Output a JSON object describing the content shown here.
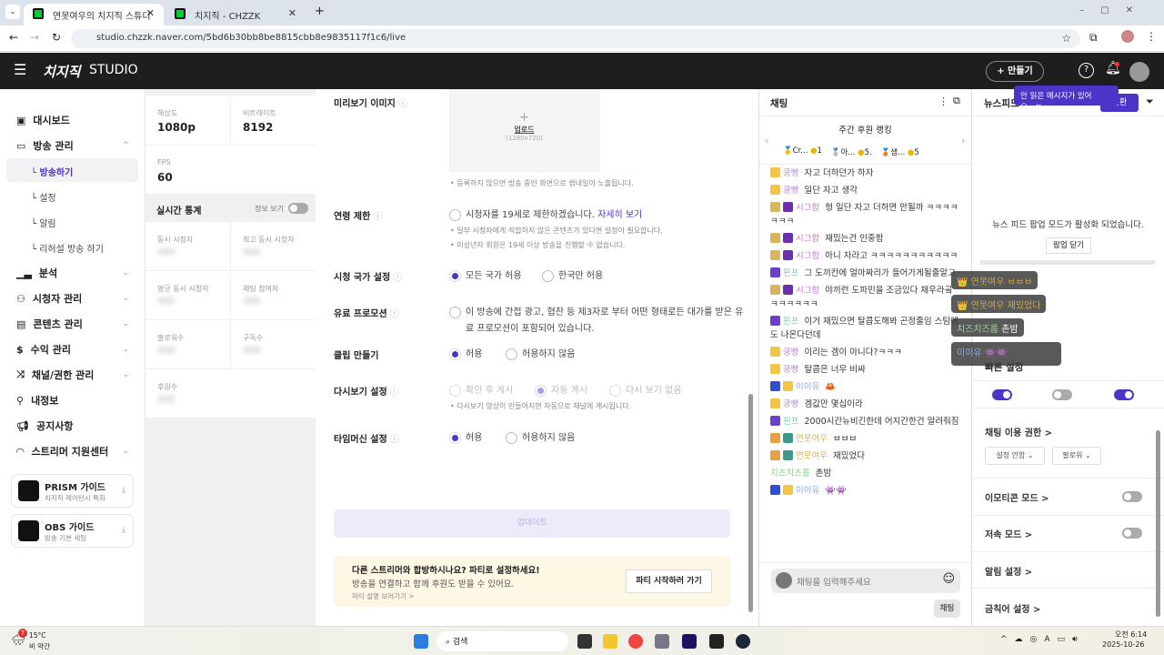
{
  "browser": {
    "tabs": [
      {
        "title": "연못여우의 치지직 스튜디오"
      },
      {
        "title": "치지직 - CHZZK"
      }
    ],
    "url": "studio.chzzk.naver.com/5bd6b30bb8be8815cbb8e9835117f1c6/live"
  },
  "header": {
    "logo": "치지직",
    "studio": "STUDIO",
    "create": "+ 만들기",
    "tooltip": "안 읽은 메시지가 있어요."
  },
  "sidebar": {
    "items": [
      "대시보드",
      "방송 관리",
      "분석",
      "시청자 관리",
      "콘텐츠 관리",
      "수익 관리",
      "채널/권한 관리",
      "내정보",
      "공지사항",
      "스트리머 지원센터"
    ],
    "sub": [
      "방송하기",
      "설정",
      "알림",
      "리허설 방송 하기"
    ],
    "guides": [
      {
        "title": "PRISM 가이드",
        "desc": "치지직 레이턴시 특화"
      },
      {
        "title": "OBS 가이드",
        "desc": "방송 기본 세팅"
      }
    ]
  },
  "stats": {
    "resolution_label": "해상도",
    "resolution": "1080p",
    "bitrate_label": "비트레이트",
    "bitrate": "8192",
    "fps_label": "FPS",
    "fps": "60",
    "realtime_title": "실시간 통계",
    "info_toggle": "정보 보기",
    "info_toggle_on": false,
    "cells": [
      "동시 시청자",
      "최고 동시 시청자",
      "평균 동시 시청자",
      "채팅 참여자",
      "팔로워수",
      "구독수",
      "후원수"
    ]
  },
  "settings": {
    "preview_label": "미리보기 이미지",
    "upload": "업로드",
    "upload_size": "(1280x720)",
    "preview_note": "• 등록하지 않으면 방송 중인 화면으로 썸네일이 노출됩니다.",
    "age_label": "연령 제한",
    "age_opt": "시청자를 19세로 제한하겠습니다.",
    "age_link": "자세히 보기",
    "age_note1": "• 일부 시청자에게 적합하지 않은 콘텐츠가 있다면 설정이 필요합니다.",
    "age_note2": "• 미성년자 회원은 19세 이상 방송을 진행할 수 없습니다.",
    "country_label": "시청 국가 설정",
    "country_all": "모든 국가 허용",
    "country_kr": "한국만 허용",
    "promo_label": "유료 프로모션",
    "promo_opt1": "이 방송에 간접 광고, 협찬 등 제3자로 부터 어떤 형태로든 대가를 받은 유",
    "promo_opt2": "료 프로모션이 포함되어 있습니다.",
    "clip_label": "클립 만들기",
    "allow": "허용",
    "disallow": "허용하지 않음",
    "replay_label": "다시보기 설정",
    "replay_opts": [
      "확인 후 게시",
      "자동 게시",
      "다시 보기 없음"
    ],
    "replay_note": "• 다시보기 영상이 만들어지면 자동으로 채널에 게시됩니다.",
    "timemachine_label": "타임머신 설정",
    "update": "업데이트",
    "party_title": "다른 스트리머와 합방하시나요? 파티로 설정하세요!",
    "party_desc": "방송을 연결하고 함께 후원도 받을 수 있어요.",
    "party_link": "파티 설명 보러가기 >",
    "party_button": "파티 시작하러 가기"
  },
  "chat": {
    "title": "채팅",
    "ranking_title": "주간 후원 랭킹",
    "ranking": [
      {
        "name": "Cr...",
        "amount": "1"
      },
      {
        "name": "아...",
        "amount": "5."
      },
      {
        "name": "샘...",
        "amount": "5"
      }
    ],
    "messages": [
      {
        "name": "쿵빵",
        "color": "#b58ad8",
        "badges": [
          "#f5c542"
        ],
        "text": "자고 더하던가 하자"
      },
      {
        "name": "쿵빵",
        "color": "#b58ad8",
        "badges": [
          "#f5c542"
        ],
        "text": "일단 자고 생각"
      },
      {
        "name": "시그함",
        "color": "#c77dc7",
        "badges": [
          "#d9b45a",
          "#6a2fb0"
        ],
        "text": "형 일단 자고 더하면 안될까 ㅋㅋㅋㅋㅋㅋㅋ"
      },
      {
        "name": "시그함",
        "color": "#c77dc7",
        "badges": [
          "#d9b45a",
          "#6a2fb0"
        ],
        "text": "재밌는건 인중함"
      },
      {
        "name": "시그함",
        "color": "#c77dc7",
        "badges": [
          "#d9b45a",
          "#6a2fb0"
        ],
        "text": "아니 자라고 ㅋㅋㅋㅋㅋㅋㅋㅋㅋㅋㅋ"
      },
      {
        "name": "핀프",
        "color": "#7fc7b5",
        "badges": [
          "#6a3fd0"
        ],
        "text": "그 도끼칸에 얼마짜리가 들어가게될줄알고"
      },
      {
        "name": "시그함",
        "color": "#c77dc7",
        "badges": [
          "#d9b45a",
          "#6a2fb0"
        ],
        "text": "야끼런 도파민을 조금있다 채우라곸ㅋㅋㅋㅋㅋㅋ"
      },
      {
        "name": "핀프",
        "color": "#7fc7b5",
        "badges": [
          "#6a3fd0"
        ],
        "text": "이거 재밌으면 탈콥도해봐 곤정줄임 스팀에도 나온다던데"
      },
      {
        "name": "쿵빵",
        "color": "#b58ad8",
        "badges": [
          "#f5c542"
        ],
        "text": "이리는 겜이 아니다?ㅋㅋㅋ"
      },
      {
        "name": "쿵빵",
        "color": "#b58ad8",
        "badges": [
          "#f5c542"
        ],
        "text": "탈콥은 너무 비싸"
      },
      {
        "name": "이이유",
        "color": "#8fa6e0",
        "badges": [
          "#2d4fd0",
          "#f5c542"
        ],
        "text": "🦀"
      },
      {
        "name": "쿵빵",
        "color": "#b58ad8",
        "badges": [
          "#f5c542"
        ],
        "text": "겜값만 몇십이라"
      },
      {
        "name": "핀프",
        "color": "#7fc7b5",
        "badges": [
          "#6a3fd0"
        ],
        "text": "2000시간뉴비긴한데 어지간한건 알려줘짐"
      },
      {
        "name": "연못여우",
        "color": "#d9b45a",
        "badges": [
          "#e8a040",
          "#3a9a8a"
        ],
        "text": "ㅂㅂㅂ"
      },
      {
        "name": "연못여우",
        "color": "#d9b45a",
        "badges": [
          "#e8a040",
          "#3a9a8a"
        ],
        "text": "재밌었다"
      },
      {
        "name": "치즈치즈룹",
        "color": "#8fd08f",
        "badges": [],
        "text": "촌밤"
      },
      {
        "name": "이이유",
        "color": "#8fa6e0",
        "badges": [
          "#2d4fd0",
          "#f5c542"
        ],
        "text": "👾👾"
      }
    ],
    "input_placeholder": "채팅을 입력해주세요",
    "send": "채팅"
  },
  "newsfeed": {
    "title": "뉴스피드",
    "button": "전환",
    "message": "뉴스 피드 팝업 모드가 활성화 되었습니다.",
    "close_popup": "팝업 닫기",
    "popups": [
      {
        "name": "연못여우",
        "text": "ㅂㅂㅂ"
      },
      {
        "name": "연못여우",
        "text": "재밌었다"
      },
      {
        "name": "치즈치즈룹",
        "text": "촌밤"
      },
      {
        "name": "이이유",
        "text": "👾👾"
      }
    ]
  },
  "quick": {
    "title": "빠른 설정",
    "toggles": [
      true,
      false,
      true
    ],
    "chat_perm": "채팅 이용 권한 >",
    "perm_opt1": "설정 안함",
    "perm_opt2": "팔로워",
    "emoticon": "이모티콘 모드 >",
    "emoticon_on": false,
    "slow": "저속 모드 >",
    "slow_on": false,
    "alert": "알림 설정 >",
    "banned": "금칙어 설정 >"
  },
  "taskbar": {
    "temp": "15°C",
    "weather": "비 약간",
    "search": "검색",
    "time": "오전 6:14",
    "date": "2025-10-26",
    "weather_badge": "7"
  }
}
